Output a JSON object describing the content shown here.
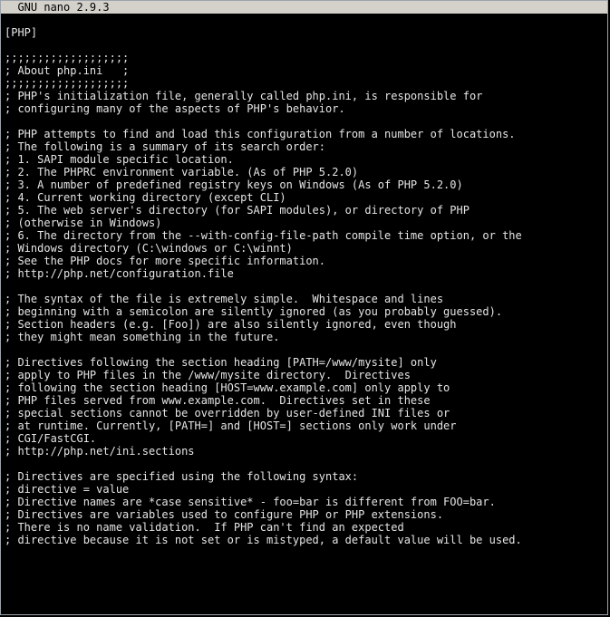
{
  "titlebar": {
    "text": "  GNU nano 2.9.3"
  },
  "lines": [
    "",
    "[PHP]",
    "",
    ";;;;;;;;;;;;;;;;;;;",
    "; About php.ini   ;",
    ";;;;;;;;;;;;;;;;;;;",
    "; PHP's initialization file, generally called php.ini, is responsible for",
    "; configuring many of the aspects of PHP's behavior.",
    "",
    "; PHP attempts to find and load this configuration from a number of locations.",
    "; The following is a summary of its search order:",
    "; 1. SAPI module specific location.",
    "; 2. The PHPRC environment variable. (As of PHP 5.2.0)",
    "; 3. A number of predefined registry keys on Windows (As of PHP 5.2.0)",
    "; 4. Current working directory (except CLI)",
    "; 5. The web server's directory (for SAPI modules), or directory of PHP",
    "; (otherwise in Windows)",
    "; 6. The directory from the --with-config-file-path compile time option, or the",
    "; Windows directory (C:\\windows or C:\\winnt)",
    "; See the PHP docs for more specific information.",
    "; http://php.net/configuration.file",
    "",
    "; The syntax of the file is extremely simple.  Whitespace and lines",
    "; beginning with a semicolon are silently ignored (as you probably guessed).",
    "; Section headers (e.g. [Foo]) are also silently ignored, even though",
    "; they might mean something in the future.",
    "",
    "; Directives following the section heading [PATH=/www/mysite] only",
    "; apply to PHP files in the /www/mysite directory.  Directives",
    "; following the section heading [HOST=www.example.com] only apply to",
    "; PHP files served from www.example.com.  Directives set in these",
    "; special sections cannot be overridden by user-defined INI files or",
    "; at runtime. Currently, [PATH=] and [HOST=] sections only work under",
    "; CGI/FastCGI.",
    "; http://php.net/ini.sections",
    "",
    "; Directives are specified using the following syntax:",
    "; directive = value",
    "; Directive names are *case sensitive* - foo=bar is different from FOO=bar.",
    "; Directives are variables used to configure PHP or PHP extensions.",
    "; There is no name validation.  If PHP can't find an expected",
    "; directive because it is not set or is mistyped, a default value will be used.",
    ""
  ]
}
